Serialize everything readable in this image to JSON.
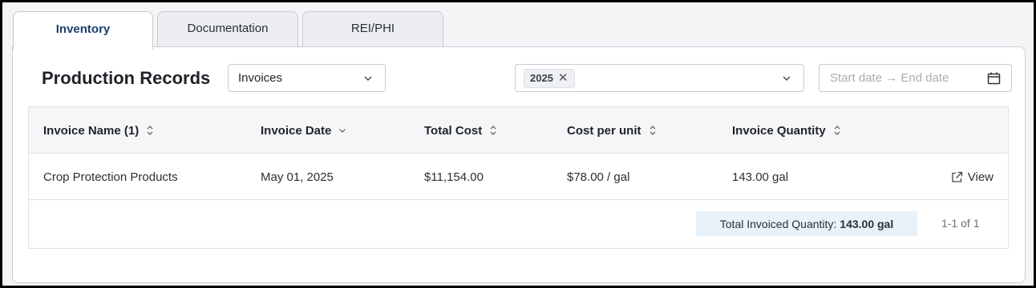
{
  "tabs": [
    {
      "label": "Inventory",
      "active": true
    },
    {
      "label": "Documentation",
      "active": false
    },
    {
      "label": "REI/PHI",
      "active": false
    }
  ],
  "header": {
    "title": "Production Records",
    "record_type": {
      "selected": "Invoices"
    },
    "year_filter": {
      "chips": [
        "2025"
      ]
    },
    "date_range": {
      "placeholder": "Start date → End date"
    }
  },
  "table": {
    "columns": [
      {
        "label": "Invoice Name (1)",
        "sort": "both"
      },
      {
        "label": "Invoice Date",
        "sort": "desc"
      },
      {
        "label": "Total Cost",
        "sort": "both"
      },
      {
        "label": "Cost per unit",
        "sort": "both"
      },
      {
        "label": "Invoice Quantity",
        "sort": "both"
      }
    ],
    "rows": [
      {
        "name": "Crop Protection Products",
        "date": "May 01, 2025",
        "total_cost": "$11,154.00",
        "cost_per_unit": "$78.00 / gal",
        "quantity": "143.00 gal",
        "action": "View"
      }
    ],
    "summary": {
      "label": "Total Invoiced Quantity:",
      "value": "143.00 gal"
    },
    "pagination": "1-1 of 1"
  },
  "colors": {
    "accent": "#1d3f6e",
    "summary_bg": "#e8f2fb"
  },
  "icons": [
    "chevron-down-icon",
    "close-icon",
    "calendar-icon",
    "sort-icon",
    "external-link-icon"
  ]
}
